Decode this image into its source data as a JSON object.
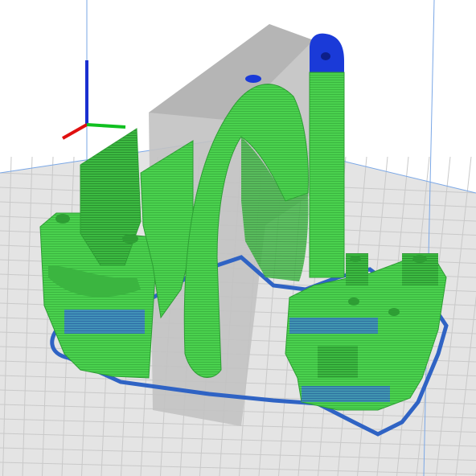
{
  "viewport": {
    "background_color": "#ffffff",
    "build_plate_color": "#e4e4e4",
    "grid_line_color": "#c9c9c9",
    "build_volume_edge_color": "#5b8fd6",
    "disallowed_area_color": "#b3b3b3",
    "layer_view": "Layer view",
    "axis_indicator": {
      "x_axis_color": "#e01010",
      "y_axis_color": "#10c020",
      "z_axis_color": "#1a2fd0"
    },
    "colors": {
      "wall_inner": "#4ad14e",
      "wall_outer": "#2e9e34",
      "infill_blue": "#2a5fb8",
      "skin_top": "#1a3ad8",
      "travel_outline": "#2f63c4"
    }
  }
}
